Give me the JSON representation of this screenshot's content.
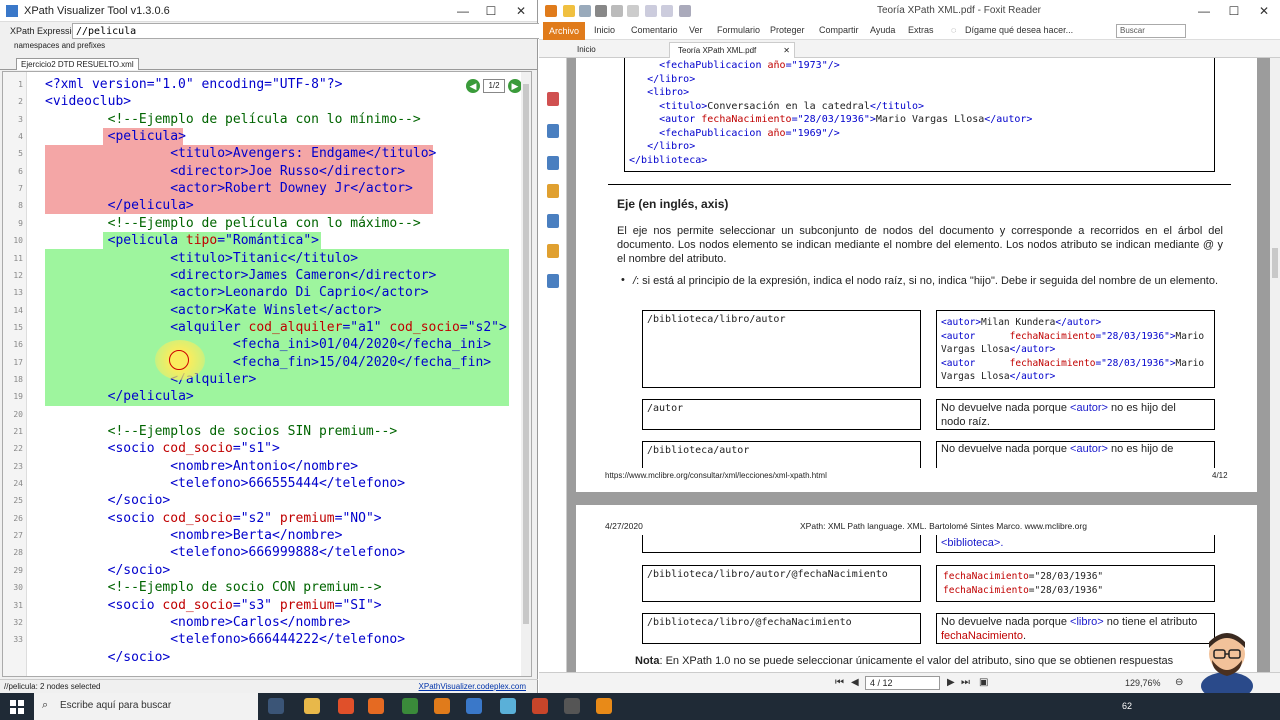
{
  "xpv": {
    "title": "XPath Visualizer Tool v1.3.0.6",
    "xpath_label": "XPath Expression",
    "xpath_value": "//pelicula",
    "namespaces_label": "namespaces and prefixes",
    "file_tab": "Ejercicio2 DTD RESUELTO.xml",
    "pager": "1/2",
    "status_left": "//pelicula: 2 nodes selected",
    "status_link": "XPathVisualizer.codeplex.com",
    "line_numbers": [
      "1",
      "2",
      "3",
      "4",
      "5",
      "6",
      "7",
      "8",
      "9",
      "10",
      "11",
      "12",
      "13",
      "14",
      "15",
      "16",
      "17",
      "18",
      "19",
      "20",
      "21",
      "22",
      "23",
      "24",
      "25",
      "26",
      "27",
      "28",
      "29",
      "30",
      "31",
      "32",
      "33"
    ],
    "code": [
      [
        [
          "t",
          "<?xml version=\"1.0\" encoding=\"UTF-8\"?>"
        ]
      ],
      [
        [
          "t",
          "<videoclub>"
        ]
      ],
      [
        [
          "s",
          "        "
        ],
        [
          "c",
          "<!--Ejemplo de película con lo mínimo-->"
        ]
      ],
      [
        [
          "s",
          "        "
        ],
        [
          "t",
          "<pelicula>"
        ]
      ],
      [
        [
          "s",
          "                "
        ],
        [
          "t",
          "<titulo>"
        ],
        [
          "x",
          "Avengers: Endgame"
        ],
        [
          "t",
          "</titulo>"
        ]
      ],
      [
        [
          "s",
          "                "
        ],
        [
          "t",
          "<director>"
        ],
        [
          "x",
          "Joe Russo"
        ],
        [
          "t",
          "</director>"
        ]
      ],
      [
        [
          "s",
          "                "
        ],
        [
          "t",
          "<actor>"
        ],
        [
          "x",
          "Robert Downey Jr"
        ],
        [
          "t",
          "</actor>"
        ]
      ],
      [
        [
          "s",
          "        "
        ],
        [
          "t",
          "</pelicula>"
        ]
      ],
      [
        [
          "s",
          "        "
        ],
        [
          "c",
          "<!--Ejemplo de película con lo máximo-->"
        ]
      ],
      [
        [
          "s",
          "        "
        ],
        [
          "t",
          "<pelicula "
        ],
        [
          "a",
          "tipo"
        ],
        [
          "t",
          "="
        ],
        [
          "v",
          "\"Romántica\""
        ],
        [
          "t",
          ">"
        ]
      ],
      [
        [
          "s",
          "                "
        ],
        [
          "t",
          "<titulo>"
        ],
        [
          "x",
          "Titanic"
        ],
        [
          "t",
          "</titulo>"
        ]
      ],
      [
        [
          "s",
          "                "
        ],
        [
          "t",
          "<director>"
        ],
        [
          "x",
          "James Cameron"
        ],
        [
          "t",
          "</director>"
        ]
      ],
      [
        [
          "s",
          "                "
        ],
        [
          "t",
          "<actor>"
        ],
        [
          "x",
          "Leonardo Di Caprio"
        ],
        [
          "t",
          "</actor>"
        ]
      ],
      [
        [
          "s",
          "                "
        ],
        [
          "t",
          "<actor>"
        ],
        [
          "x",
          "Kate Winslet"
        ],
        [
          "t",
          "</actor>"
        ]
      ],
      [
        [
          "s",
          "                "
        ],
        [
          "t",
          "<alquiler "
        ],
        [
          "a",
          "cod_alquiler"
        ],
        [
          "t",
          "="
        ],
        [
          "v",
          "\"a1\""
        ],
        [
          "t",
          " "
        ],
        [
          "a",
          "cod_socio"
        ],
        [
          "t",
          "="
        ],
        [
          "v",
          "\"s2\""
        ],
        [
          "t",
          ">"
        ]
      ],
      [
        [
          "s",
          "                        "
        ],
        [
          "t",
          "<fecha_ini>"
        ],
        [
          "x",
          "01/04/2020"
        ],
        [
          "t",
          "</fecha_ini>"
        ]
      ],
      [
        [
          "s",
          "                        "
        ],
        [
          "t",
          "<fecha_fin>"
        ],
        [
          "x",
          "15/04/2020"
        ],
        [
          "t",
          "</fecha_fin>"
        ]
      ],
      [
        [
          "s",
          "                "
        ],
        [
          "t",
          "</alquiler>"
        ]
      ],
      [
        [
          "s",
          "        "
        ],
        [
          "t",
          "</pelicula>"
        ]
      ],
      [],
      [
        [
          "s",
          "        "
        ],
        [
          "c",
          "<!--Ejemplos de socios SIN premium-->"
        ]
      ],
      [
        [
          "s",
          "        "
        ],
        [
          "t",
          "<socio "
        ],
        [
          "a",
          "cod_socio"
        ],
        [
          "t",
          "="
        ],
        [
          "v",
          "\"s1\""
        ],
        [
          "t",
          ">"
        ]
      ],
      [
        [
          "s",
          "                "
        ],
        [
          "t",
          "<nombre>"
        ],
        [
          "x",
          "Antonio"
        ],
        [
          "t",
          "</nombre>"
        ]
      ],
      [
        [
          "s",
          "                "
        ],
        [
          "t",
          "<telefono>"
        ],
        [
          "x",
          "666555444"
        ],
        [
          "t",
          "</telefono>"
        ]
      ],
      [
        [
          "s",
          "        "
        ],
        [
          "t",
          "</socio>"
        ]
      ],
      [
        [
          "s",
          "        "
        ],
        [
          "t",
          "<socio "
        ],
        [
          "a",
          "cod_socio"
        ],
        [
          "t",
          "="
        ],
        [
          "v",
          "\"s2\""
        ],
        [
          "t",
          " "
        ],
        [
          "a",
          "premium"
        ],
        [
          "t",
          "="
        ],
        [
          "v",
          "\"NO\""
        ],
        [
          "t",
          ">"
        ]
      ],
      [
        [
          "s",
          "                "
        ],
        [
          "t",
          "<nombre>"
        ],
        [
          "x",
          "Berta"
        ],
        [
          "t",
          "</nombre>"
        ]
      ],
      [
        [
          "s",
          "                "
        ],
        [
          "t",
          "<telefono>"
        ],
        [
          "x",
          "666999888"
        ],
        [
          "t",
          "</telefono>"
        ]
      ],
      [
        [
          "s",
          "        "
        ],
        [
          "t",
          "</socio>"
        ]
      ],
      [
        [
          "s",
          "        "
        ],
        [
          "c",
          "<!--Ejemplo de socio CON premium-->"
        ]
      ],
      [
        [
          "s",
          "        "
        ],
        [
          "t",
          "<socio "
        ],
        [
          "a",
          "cod_socio"
        ],
        [
          "t",
          "="
        ],
        [
          "v",
          "\"s3\""
        ],
        [
          "t",
          " "
        ],
        [
          "a",
          "premium"
        ],
        [
          "t",
          "="
        ],
        [
          "v",
          "\"SI\""
        ],
        [
          "t",
          ">"
        ]
      ],
      [
        [
          "s",
          "                "
        ],
        [
          "t",
          "<nombre>"
        ],
        [
          "x",
          "Carlos"
        ],
        [
          "t",
          "</nombre>"
        ]
      ],
      [
        [
          "s",
          "                "
        ],
        [
          "t",
          "<telefono>"
        ],
        [
          "x",
          "666444222"
        ],
        [
          "t",
          "</telefono>"
        ]
      ],
      [
        [
          "s",
          "        "
        ],
        [
          "t",
          "</socio>"
        ]
      ]
    ],
    "highlight_colors": {
      "first_match": "#f4a6a6",
      "second_match": "#9ef59e"
    }
  },
  "foxit": {
    "title": "Teoría XPath XML.pdf - Foxit Reader",
    "menu": [
      "Archivo",
      "Inicio",
      "Comentario",
      "Ver",
      "Formulario",
      "Proteger",
      "Compartir",
      "Ayuda",
      "Extras"
    ],
    "tell_me": "Dígame qué desea hacer...",
    "search_placeholder": "Buscar",
    "tabs": [
      "Inicio",
      "Teoría XPath XML.pdf"
    ],
    "page4": {
      "top_code": [
        [
          [
            "s",
            "     "
          ],
          [
            "t",
            "<"
          ],
          [
            "t",
            "fechaPublicacion "
          ],
          [
            "a",
            "año"
          ],
          [
            "t",
            "="
          ],
          [
            "v",
            "\"1973\""
          ],
          [
            "t",
            "/>"
          ]
        ],
        [
          [
            "s",
            "   "
          ],
          [
            "t",
            "</libro>"
          ]
        ],
        [
          [
            "s",
            "   "
          ],
          [
            "t",
            "<libro>"
          ]
        ],
        [
          [
            "s",
            "     "
          ],
          [
            "t",
            "<titulo>"
          ],
          [
            "k",
            "Conversación en la catedral"
          ],
          [
            "t",
            "</titulo>"
          ]
        ],
        [
          [
            "s",
            "     "
          ],
          [
            "t",
            "<autor "
          ],
          [
            "a",
            "fechaNacimiento"
          ],
          [
            "t",
            "="
          ],
          [
            "v",
            "\"28/03/1936\""
          ],
          [
            "t",
            ">"
          ],
          [
            "k",
            "Mario Vargas Llosa"
          ],
          [
            "t",
            "</autor>"
          ]
        ],
        [
          [
            "s",
            "     "
          ],
          [
            "t",
            "<fechaPublicacion "
          ],
          [
            "a",
            "año"
          ],
          [
            "t",
            "="
          ],
          [
            "v",
            "\"1969\""
          ],
          [
            "t",
            "/>"
          ]
        ],
        [
          [
            "s",
            "   "
          ],
          [
            "t",
            "</libro>"
          ]
        ],
        [
          [
            "t",
            "</biblioteca>"
          ]
        ]
      ],
      "heading": "Eje (en inglés, axis)",
      "para": "El eje nos permite seleccionar un subconjunto de nodos del documento y corresponde a recorridos en el árbol del documento. Los nodos elemento se indican mediante el nombre del elemento. Los nodos atributo se indican mediante @ y el nombre del atributo.",
      "bullet_sym": "/",
      "bullet_text": ": si está al principio de la expresión, indica el nodo raíz, si no, indica \"hijo\". Debe ir seguida del nombre de un elemento.",
      "rows": [
        {
          "expr": "/biblioteca/libro/autor",
          "res": [
            [
              [
                "t",
                "<autor>"
              ],
              [
                "k",
                "Milan Kundera"
              ],
              [
                "t",
                "</autor>"
              ]
            ],
            [
              [
                "t",
                "<autor      "
              ],
              [
                "a",
                "fechaNacimiento"
              ],
              [
                "t",
                "="
              ],
              [
                "v",
                "\"28/03/1936\""
              ],
              [
                "t",
                ">"
              ],
              [
                "k",
                "Mario"
              ]
            ],
            [
              [
                "k",
                "Vargas Llosa"
              ],
              [
                "t",
                "</autor>"
              ]
            ],
            [
              [
                "t",
                "<autor      "
              ],
              [
                "a",
                "fechaNacimiento"
              ],
              [
                "t",
                "="
              ],
              [
                "v",
                "\"28/03/1936\""
              ],
              [
                "t",
                ">"
              ],
              [
                "k",
                "Mario"
              ]
            ],
            [
              [
                "k",
                "Vargas Llosa"
              ],
              [
                "t",
                "</autor>"
              ]
            ]
          ]
        },
        {
          "expr": "/autor",
          "text_a": "No devuelve nada porque ",
          "tag": "<autor>",
          "text_b": " no es hijo del",
          "text_c": "nodo raíz."
        },
        {
          "expr": "/biblioteca/autor",
          "text_a": "No devuelve nada porque ",
          "tag": "<autor>",
          "text_b": " no es hijo de"
        }
      ],
      "footer_url": "https://www.mclibre.org/consultar/xml/lecciones/xml-xpath.html",
      "footer_page": "4/12"
    },
    "page5": {
      "header_date": "4/27/2020",
      "header_title": "XPath: XML Path language. XML. Bartolomé Sintes Marco. www.mclibre.org",
      "cont_text": "<biblioteca>.",
      "rows": [
        {
          "expr": "/biblioteca/libro/autor/@fechaNacimiento",
          "res1": "fechaNacimiento",
          "val1": "=\"28/03/1936\"",
          "res2": "fechaNacimiento",
          "val2": "=\"28/03/1936\""
        },
        {
          "expr": "/biblioteca/libro/@fechaNacimiento",
          "text_a": "No devuelve nada porque ",
          "tag": "<libro>",
          "text_b": " no tiene el atributo",
          "attr": "fechaNacimiento",
          "text_c": "."
        }
      ],
      "note_label": "Nota",
      "note_text": ": En XPath 1.0 no se puede seleccionar únicamente el valor del atributo, sino que se obtienen respuestas"
    },
    "status": {
      "page": "4 / 12",
      "zoom": "129,76%"
    }
  },
  "taskbar": {
    "search_placeholder": "Escribe aquí para buscar",
    "tray_num": "62"
  }
}
